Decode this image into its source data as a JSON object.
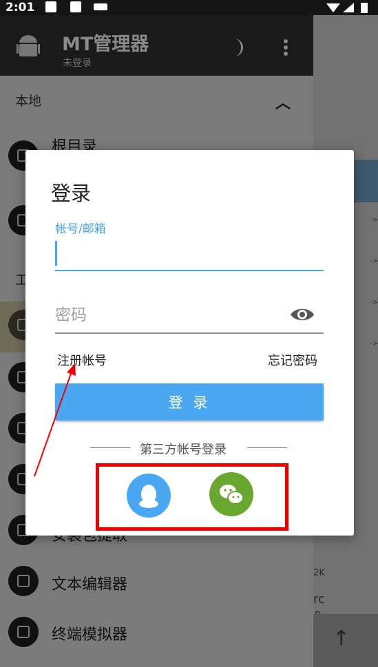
{
  "status_bar": {
    "time": "2:01"
  },
  "app_bar": {
    "title": "MT管理器",
    "subtitle": "未登录"
  },
  "drawer": {
    "section_label": "本地",
    "items": [
      {
        "label": "根目录",
        "icon": "phone-icon"
      },
      {
        "label": "",
        "icon": "android-icon"
      },
      {
        "label": "工",
        "icon": ""
      },
      {
        "label": "",
        "icon": "badge-icon"
      },
      {
        "label": "",
        "icon": "puzzle-icon"
      },
      {
        "label": "",
        "icon": "box-icon"
      },
      {
        "label": "",
        "icon": "pencil-icon"
      },
      {
        "label": "安装包提取",
        "icon": "layers-icon"
      },
      {
        "label": "文本编辑器",
        "icon": "document-icon"
      },
      {
        "label": "终端模拟器",
        "icon": "terminal-icon"
      }
    ]
  },
  "right_pane": {
    "size_text": "2K",
    "name_text": "rc",
    "unit_text": "B"
  },
  "login_dialog": {
    "title": "登录",
    "account_label": "帐号/邮箱",
    "account_value": "",
    "password_placeholder": "密码",
    "register_link": "注册帐号",
    "forgot_link": "忘记密码",
    "login_button": "登 录",
    "third_party_label": "第三方帐号登录",
    "third_party": [
      {
        "name": "qq-icon",
        "color": "#4aa8f3"
      },
      {
        "name": "wechat-icon",
        "color": "#6aa730"
      }
    ]
  },
  "colors": {
    "accent": "#42a5f5",
    "annotation": "#f20000"
  }
}
